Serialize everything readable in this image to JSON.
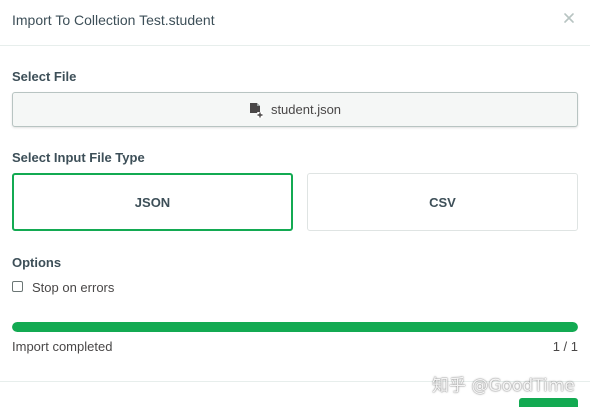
{
  "modal": {
    "title": "Import To Collection Test.student",
    "close_icon": "close-icon"
  },
  "select_file": {
    "label": "Select File",
    "file_name": "student.json",
    "icon": "file-add-icon"
  },
  "file_type": {
    "label": "Select Input File Type",
    "options": [
      {
        "label": "JSON",
        "selected": true
      },
      {
        "label": "CSV",
        "selected": false
      }
    ]
  },
  "options": {
    "label": "Options",
    "stop_on_errors_label": "Stop on errors",
    "stop_on_errors_checked": false
  },
  "progress": {
    "fraction": 1.0,
    "status": "Import completed",
    "count": "1 / 1"
  },
  "colors": {
    "accent": "#13aa52",
    "text": "#3d4f58",
    "border": "#dfe4e3"
  },
  "watermark": "知乎 @GoodTime"
}
